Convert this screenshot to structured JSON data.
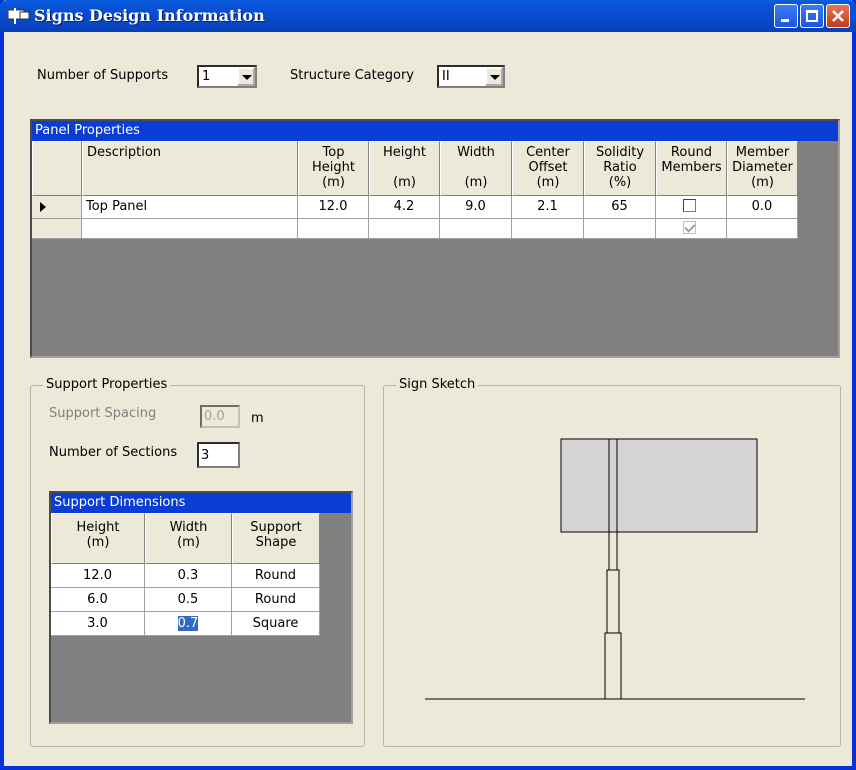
{
  "window": {
    "title": "Signs Design Information",
    "icon": "sign-icon"
  },
  "top": {
    "num_supports_label": "Number of Supports",
    "num_supports_value": "1",
    "structure_category_label": "Structure Category",
    "structure_category_value": "II"
  },
  "panel_properties": {
    "caption": "Panel Properties",
    "headers": {
      "description": "Description",
      "top_height": "Top\nHeight\n(m)",
      "height": "Height\n\n(m)",
      "width": "Width\n\n(m)",
      "center_offset": "Center\nOffset\n(m)",
      "solidity_ratio": "Solidity\nRatio\n(%)",
      "round_members": "Round\nMembers",
      "member_diameter": "Member\nDiameter\n(m)"
    },
    "rows": [
      {
        "description": "Top Panel",
        "top_height": "12.0",
        "height": "4.2",
        "width": "9.0",
        "center_offset": "2.1",
        "solidity_ratio": "65",
        "round_members": false,
        "member_diameter": "0.0"
      }
    ],
    "new_row_round_members": true
  },
  "support_properties": {
    "group_title": "Support Properties",
    "spacing_label": "Support Spacing",
    "spacing_value": "0.0",
    "spacing_unit": "m",
    "sections_label": "Number of Sections",
    "sections_value": "3",
    "dimensions": {
      "caption": "Support Dimensions",
      "headers": {
        "height": "Height\n(m)",
        "width": "Width\n(m)",
        "shape": "Support\nShape"
      },
      "rows": [
        {
          "height": "12.0",
          "width": "0.3",
          "shape": "Round"
        },
        {
          "height": "6.0",
          "width": "0.5",
          "shape": "Round"
        },
        {
          "height": "3.0",
          "width": "0.7",
          "shape": "Square"
        }
      ]
    }
  },
  "sign_sketch": {
    "group_title": "Sign Sketch",
    "panel_fill": "#d4d4d4"
  },
  "colors": {
    "titlebar": "#0852d6",
    "grid_caption": "#0a3cd6",
    "grid_background": "#808080",
    "window_bg": "#ece9d8",
    "selection": "#316ac5"
  }
}
